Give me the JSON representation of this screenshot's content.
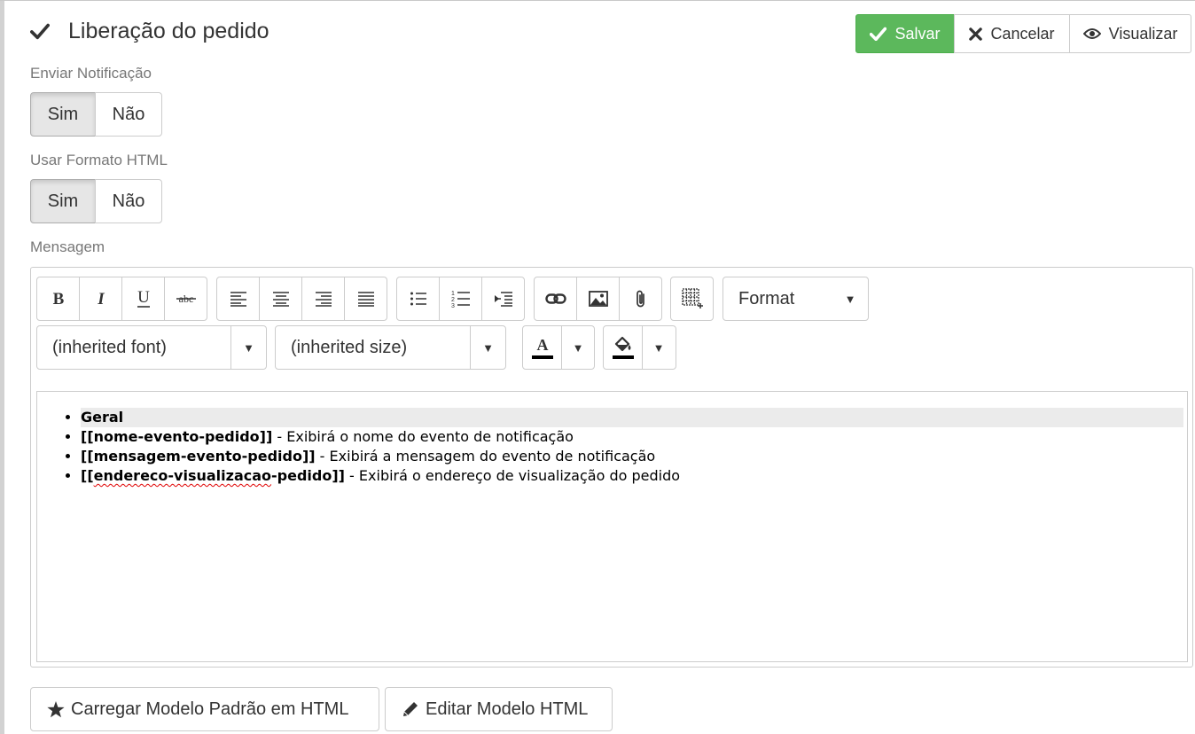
{
  "page": {
    "title": "Liberação do pedido"
  },
  "actions": {
    "save": "Salvar",
    "cancel": "Cancelar",
    "preview": "Visualizar"
  },
  "send_notification": {
    "label": "Enviar Notificação",
    "yes": "Sim",
    "no": "Não",
    "selected": "Sim"
  },
  "html_format": {
    "label": "Usar Formato HTML",
    "yes": "Sim",
    "no": "Não",
    "selected": "Sim"
  },
  "message": {
    "label": "Mensagem",
    "toolbar": {
      "format": "Format",
      "font": "(inherited font)",
      "size": "(inherited size)",
      "text_color_glyph": "A",
      "caret": "▼"
    },
    "content": {
      "items": [
        {
          "bold": "Geral",
          "rest": ""
        },
        {
          "bold": "[[nome-evento-pedido]]",
          "rest": " - Exibirá o nome do evento de notificação"
        },
        {
          "bold": "[[mensagem-evento-pedido]]",
          "rest": " - Exibirá a mensagem do evento de notificação"
        },
        {
          "bold_prefix": "[[",
          "bold_misspelled": "endereco-visualizacao",
          "bold_suffix": "-pedido]]",
          "rest": " - Exibirá o endereço de visualização do pedido"
        }
      ]
    }
  },
  "footer": {
    "load_default": "Carregar Modelo Padrão em HTML",
    "edit_html": "Editar Modelo HTML"
  },
  "colors": {
    "success": "#5cb85c",
    "text_color_bar": "#000000",
    "highlight_bar": "#000000"
  }
}
